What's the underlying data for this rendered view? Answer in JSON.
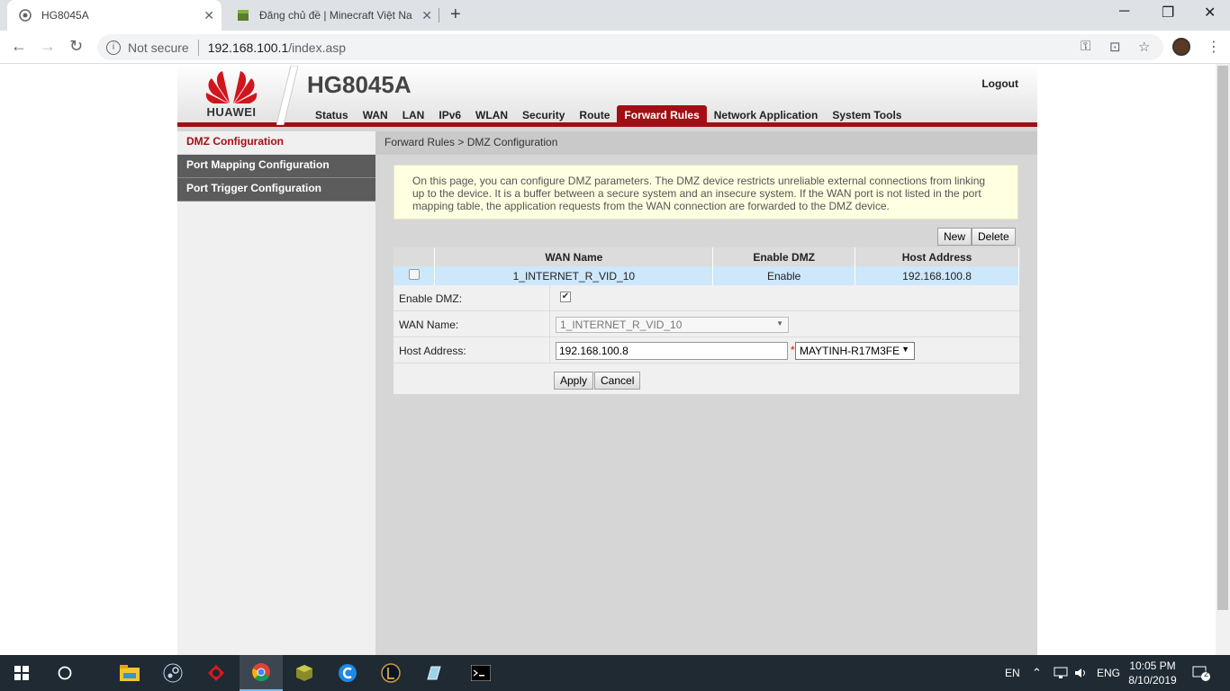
{
  "browser": {
    "tabs": [
      {
        "title": "HG8045A",
        "active": true
      },
      {
        "title": "Đăng chủ đề | Minecraft Việt Nam",
        "active": false
      }
    ],
    "address": {
      "security": "Not secure",
      "host": "192.168.100.1",
      "path": "/index.asp"
    }
  },
  "router": {
    "brand": "HUAWEI",
    "product": "HG8045A",
    "logout": "Logout",
    "menu": [
      "Status",
      "WAN",
      "LAN",
      "IPv6",
      "WLAN",
      "Security",
      "Route",
      "Forward Rules",
      "Network Application",
      "System Tools"
    ],
    "active_menu": "Forward Rules",
    "sidebar": [
      {
        "label": "DMZ Configuration",
        "active": true
      },
      {
        "label": "Port Mapping Configuration",
        "active": false
      },
      {
        "label": "Port Trigger Configuration",
        "active": false
      }
    ],
    "breadcrumb": "Forward Rules > DMZ Configuration",
    "notice": "On this page, you can configure DMZ parameters. The DMZ device restricts unreliable external connections from linking up to the device. It is a buffer between a secure system and an insecure system. If the WAN port is not listed in the port mapping table, the application requests from the WAN connection are forwarded to the DMZ device.",
    "buttons": {
      "new": "New",
      "delete": "Delete",
      "apply": "Apply",
      "cancel": "Cancel"
    },
    "table": {
      "headers": [
        "",
        "WAN Name",
        "Enable DMZ",
        "Host Address"
      ],
      "rows": [
        {
          "wan_name": "1_INTERNET_R_VID_10",
          "enable_dmz": "Enable",
          "host_address": "192.168.100.8",
          "selected": false
        }
      ]
    },
    "form": {
      "enable_dmz_label": "Enable DMZ:",
      "enable_dmz_checked": true,
      "wan_name_label": "WAN Name:",
      "wan_name_value": "1_INTERNET_R_VID_10",
      "host_address_label": "Host Address:",
      "host_address_value": "192.168.100.8",
      "required_mark": "*",
      "host_select_value": "MAYTINH-R17M3FE"
    }
  },
  "taskbar": {
    "lang_short": "EN",
    "lang": "ENG",
    "time": "10:05 PM",
    "date": "8/10/2019",
    "notifications": "2"
  }
}
